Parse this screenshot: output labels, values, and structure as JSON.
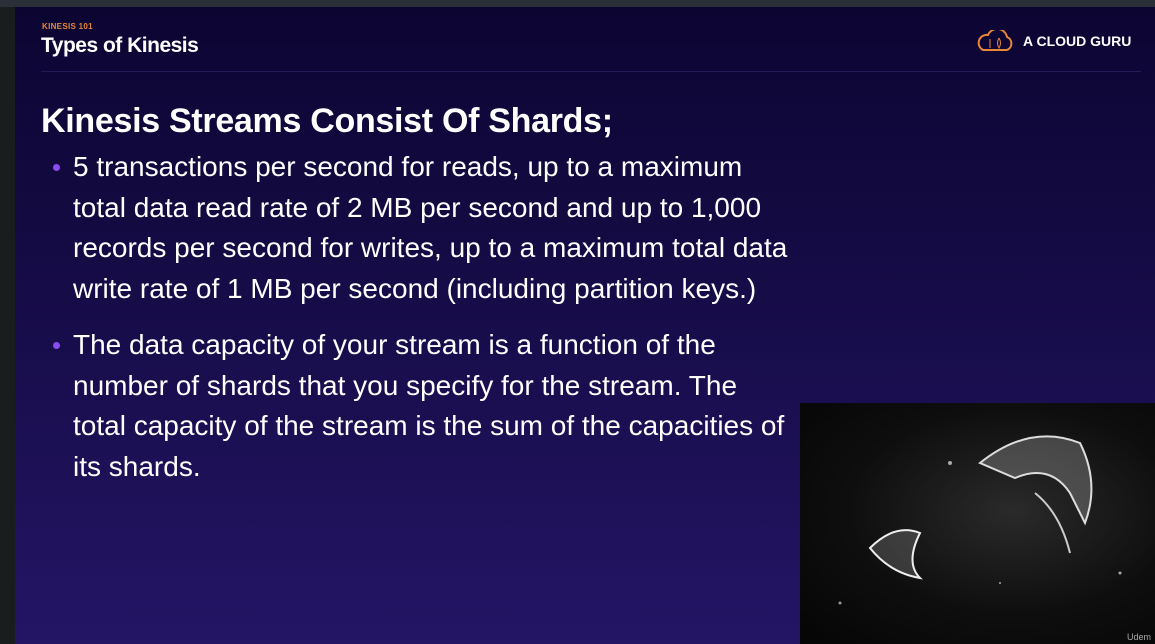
{
  "header": {
    "kicker": "KINESIS 101",
    "title": "Types of Kinesis",
    "logo_text": "A CLOUD GURU"
  },
  "content": {
    "heading": "Kinesis Streams Consist Of Shards;",
    "bullets": [
      "5 transactions per second for reads, up to a maximum total data read rate of 2 MB per second and up to 1,000 records per second for writes, up to a maximum total data write rate of 1 MB per second (including partition keys.)",
      "The data capacity of your stream is a function of the number of shards that you specify for the stream. The total capacity of the stream is the sum of the capacities of its shards."
    ]
  },
  "image": {
    "watermark": "Udem"
  },
  "colors": {
    "accent": "#e8873a",
    "bullet": "#8a4cf0"
  }
}
